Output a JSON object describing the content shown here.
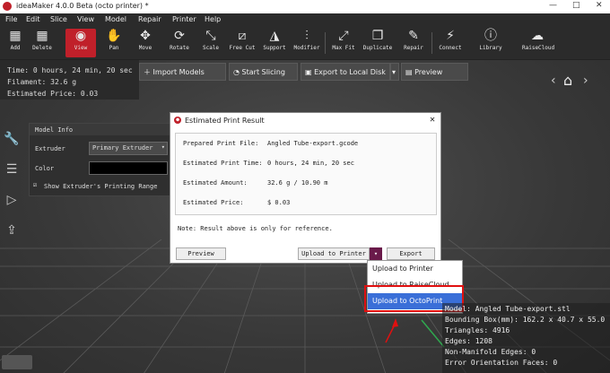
{
  "window": {
    "title": "ideaMaker 4.0.0 Beta (octo printer)  *"
  },
  "menu": [
    "File",
    "Edit",
    "Slice",
    "View",
    "Model",
    "Repair",
    "Printer",
    "Help"
  ],
  "toolbar": [
    {
      "label": "Add",
      "icon": "▦"
    },
    {
      "label": "Delete",
      "icon": "▦"
    },
    {
      "label": "View",
      "icon": "◉"
    },
    {
      "label": "Pan",
      "icon": "✋"
    },
    {
      "label": "Move",
      "icon": "✥"
    },
    {
      "label": "Rotate",
      "icon": "⟳"
    },
    {
      "label": "Scale",
      "icon": "⤡"
    },
    {
      "label": "Free Cut",
      "icon": "⧄"
    },
    {
      "label": "Support",
      "icon": "◮"
    },
    {
      "label": "Modifier",
      "icon": "⫶"
    },
    {
      "label": "Max Fit",
      "icon": "⤢"
    },
    {
      "label": "Duplicate",
      "icon": "❐"
    },
    {
      "label": "Repair",
      "icon": "✎"
    },
    {
      "label": "Connect",
      "icon": "⚡"
    },
    {
      "label": "Library",
      "icon": "ⓘ"
    },
    {
      "label": "RaiseCloud",
      "icon": "☁"
    }
  ],
  "estimate": {
    "time": "Time: 0 hours, 24 min, 20 sec",
    "filament": "Filament: 32.6 g",
    "price": "Estimated Price: 0.03"
  },
  "actions": {
    "import": "Import Models",
    "slice": "Start Slicing",
    "export": "Export to Local Disk",
    "preview": "Preview"
  },
  "model_info": {
    "title": "Model Info",
    "extruder_label": "Extruder",
    "extruder_value": "Primary Extruder",
    "color_label": "Color",
    "checkbox_label": "Show Extruder's Printing Range"
  },
  "dialog": {
    "title": "Estimated Print Result",
    "rows": [
      {
        "key": "Prepared Print File:",
        "value": "Angled Tube-export.gcode"
      },
      {
        "key": "Estimated Print Time:",
        "value": "0 hours, 24 min, 20 sec"
      },
      {
        "key": "Estimated Amount:",
        "value": "32.6 g / 10.90 m"
      },
      {
        "key": "Estimated Price:",
        "value": "$ 0.03"
      }
    ],
    "note": "Note: Result above is only for reference.",
    "preview_btn": "Preview",
    "upload_btn": "Upload to Printer",
    "export_btn": "Export"
  },
  "dropdown": [
    "Upload to Printer",
    "Upload to RaiseCloud",
    "Upload to OctoPrint"
  ],
  "stats": {
    "model": "Model: Angled Tube-export.stl",
    "bbox": "Bounding Box(mm): 162.2 x 40.7 x 55.0",
    "triangles": "Triangles: 4916",
    "edges": "Edges: 1208",
    "nonmanifold": "Non-Manifold Edges: 0",
    "orientation": "Error Orientation Faces: 0"
  },
  "colors": {
    "accent": "#c0202a",
    "selection": "#3a6fd8",
    "highlight": "#e01010"
  }
}
